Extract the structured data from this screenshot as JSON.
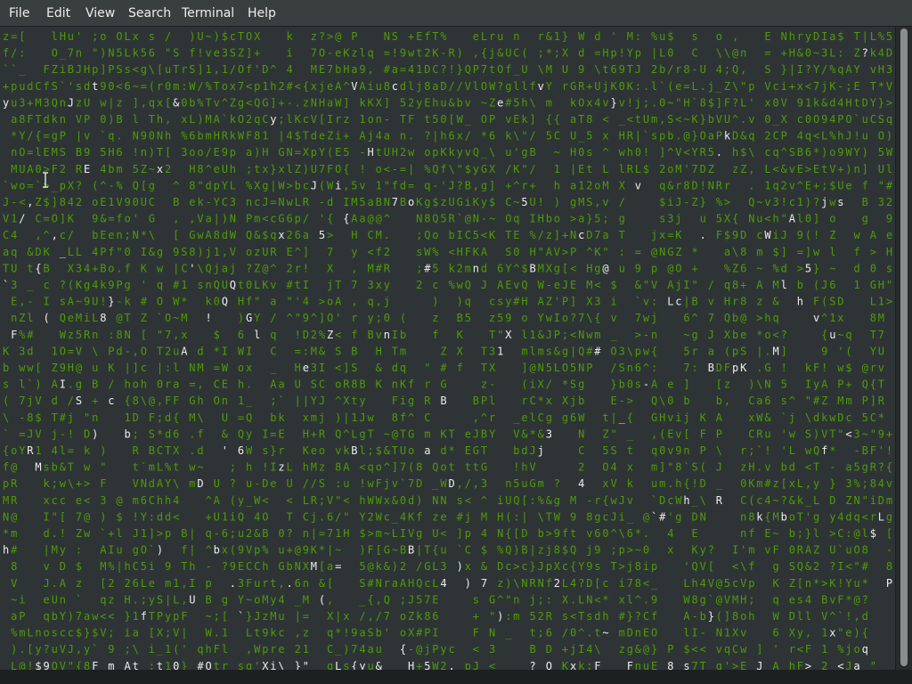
{
  "menubar": {
    "items": [
      {
        "label": "File"
      },
      {
        "label": "Edit"
      },
      {
        "label": "View"
      },
      {
        "label": "Search"
      },
      {
        "label": "Terminal"
      },
      {
        "label": "Help"
      }
    ]
  },
  "terminal": {
    "foreground": "#4e9a06",
    "highlight": "#eeeeec",
    "background": "#2e3436",
    "rain_seed": 9137,
    "rain_glyphs": "ABCDEFGHIJKLMNOPQRSTUVWXYZabcdefghijklmnopqrstuvwxyz0123456789!@#$%^&*()_+-=[]{};:'\\\",.<>/?|`~"
  },
  "scrollbar": {
    "position": 1.0
  },
  "pointer": {
    "icon": "text-ibeam-icon"
  }
}
